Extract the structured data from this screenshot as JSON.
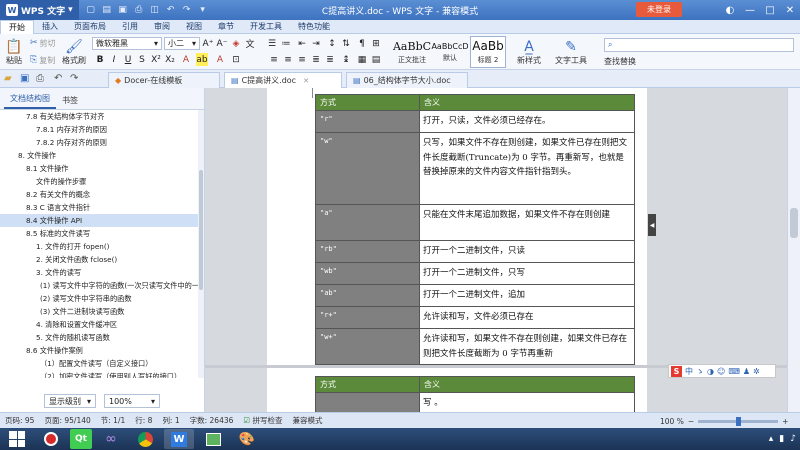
{
  "window": {
    "app_name": "WPS 文字",
    "title": "C提高讲义.doc - WPS 文字 - 兼容模式",
    "login_label": "未登录",
    "minimize": "—",
    "maximize": "□",
    "close": "✕"
  },
  "menu": {
    "tabs": [
      "开始",
      "插入",
      "页面布局",
      "引用",
      "审阅",
      "视图",
      "章节",
      "开发工具",
      "特色功能"
    ],
    "active": 0
  },
  "ribbon": {
    "paste": "粘贴",
    "cut": "剪切",
    "copy": "复制",
    "format_painter": "格式刷",
    "font_name": "微软雅黑",
    "font_size": "小二",
    "styles": [
      {
        "sample": "AaBbC",
        "label": "正文批注"
      },
      {
        "sample": "AaBbCcD",
        "label": "默认"
      },
      {
        "sample": "AaBb",
        "label": "标题 2"
      }
    ],
    "new_style": "新样式",
    "text_tools": "文字工具",
    "find_replace": "查找替换"
  },
  "doc_tabs": [
    {
      "label": "Docer-在线模板"
    },
    {
      "label": "C提高讲义.doc"
    },
    {
      "label": "06_结构体字节大小.doc"
    }
  ],
  "nav": {
    "tabs": [
      "文档结构图",
      "书签"
    ],
    "items": [
      {
        "text": "7.8 有关结构体字节对齐",
        "indent": 26
      },
      {
        "text": "7.8.1 内存对齐的原因",
        "indent": 36
      },
      {
        "text": "7.8.2 内存对齐的原则",
        "indent": 36
      },
      {
        "text": "8. 文件操作",
        "indent": 18
      },
      {
        "text": "8.1 文件操作",
        "indent": 26
      },
      {
        "text": "文件的操作步骤",
        "indent": 36
      },
      {
        "text": "8.2 有关文件的概念",
        "indent": 26
      },
      {
        "text": "8.3 C 语言文件指针",
        "indent": 26
      },
      {
        "text": "8.4 文件操作 API",
        "indent": 26
      },
      {
        "text": "8.5 标准的文件读写",
        "indent": 26
      },
      {
        "text": "1. 文件的打开 fopen()",
        "indent": 36
      },
      {
        "text": "2. 关闭文件函数 fclose()",
        "indent": 36
      },
      {
        "text": "3. 文件的读写",
        "indent": 36
      },
      {
        "text": "(1) 读写文件中字符的函数(一次只读写文件中的一个字符)",
        "indent": 40
      },
      {
        "text": "(2) 读写文件中字符串的函数",
        "indent": 40
      },
      {
        "text": "(3) 文件二进制块读写函数",
        "indent": 40
      },
      {
        "text": "4. 清除和设置文件缓冲区",
        "indent": 36
      },
      {
        "text": "5. 文件的随机读写函数",
        "indent": 36
      },
      {
        "text": "8.6 文件操作案例",
        "indent": 26
      },
      {
        "text": "（1）配置文件读写（自定义接口）",
        "indent": 40
      },
      {
        "text": "（2）加密文件读写（使用别人写好的接口）",
        "indent": 40
      }
    ],
    "selected": 8,
    "display_level": "显示级别",
    "zoom": "100%"
  },
  "document": {
    "table_header": [
      "方式",
      "含义"
    ],
    "rows": [
      {
        "mode": "\"r\"",
        "meaning": "打开，只读，文件必须已经存在。",
        "h": 22
      },
      {
        "mode": "\"w\"",
        "meaning": "只写，如果文件不存在则创建，如果文件已存在则把文件长度截断(Truncate)为 0 字节。再重新写，也就是替换掉原来的文件内容文件指针指到头。",
        "h": 72
      },
      {
        "mode": "\"a\"",
        "meaning": "只能在文件末尾追加数据，如果文件不存在则创建",
        "h": 36
      },
      {
        "mode": "\"rb\"",
        "meaning": "打开一个二进制文件，只读",
        "h": 22
      },
      {
        "mode": "\"wb\"",
        "meaning": "打开一个二进制文件，只写",
        "h": 22
      },
      {
        "mode": "\"ab\"",
        "meaning": "打开一个二进制文件，追加",
        "h": 22
      },
      {
        "mode": "\"r+\"",
        "meaning": "允许读和写，文件必须已存在",
        "h": 22
      },
      {
        "mode": "\"w+\"",
        "meaning": "允许读和写，如果文件不存在则创建，如果文件已存在则把文件长度截断为 0 字节再重新",
        "h": 36
      }
    ],
    "page2_header": [
      "方式",
      "含义"
    ],
    "page2_row": {
      "mode": "",
      "meaning": "写 。"
    }
  },
  "status": {
    "page": "页码: 95",
    "pages": "页面: 95/140",
    "section": "节: 1/1",
    "row": "行: 8",
    "col": "列: 1",
    "words": "字数: 26436",
    "spell": "拼写检查",
    "compat": "兼容模式",
    "zoom": "100 %"
  },
  "taskbar": {
    "time": "",
    "icons": [
      "record",
      "qt",
      "visual-studio",
      "chrome",
      "wps",
      "image",
      "paint"
    ]
  }
}
